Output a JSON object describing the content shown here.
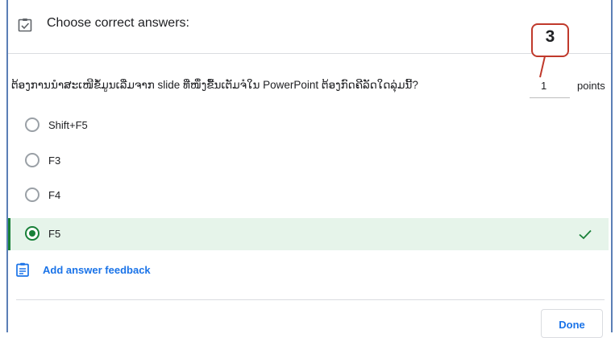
{
  "header": {
    "title": "Choose correct answers:",
    "icon": "assignment-check-icon"
  },
  "callout": {
    "number": "3",
    "color": "#c0392b"
  },
  "question": {
    "text": "ຕ້ອງການນຳສະເໜີຂໍ້ມູນເລີ່ມຈາກ slide ທີ່ໜຶ່ງຂື້ນເຕັມຈໍໃນ PowerPoint ຕ້ອງກົດຄີລັດໃດລຸ່ມນີ້?",
    "points_value": "1",
    "points_label": "points"
  },
  "options": [
    {
      "label": "Shift+F5",
      "selected": false
    },
    {
      "label": "F3",
      "selected": false
    },
    {
      "label": "F4",
      "selected": false
    },
    {
      "label": "F5",
      "selected": true
    }
  ],
  "feedback": {
    "label": "Add answer feedback",
    "icon": "feedback-icon"
  },
  "footer": {
    "done_label": "Done"
  },
  "colors": {
    "accent": "#1a73e8",
    "correct": "#188038",
    "correct_bg": "#e6f4ea",
    "frame": "#5b7fb6"
  }
}
